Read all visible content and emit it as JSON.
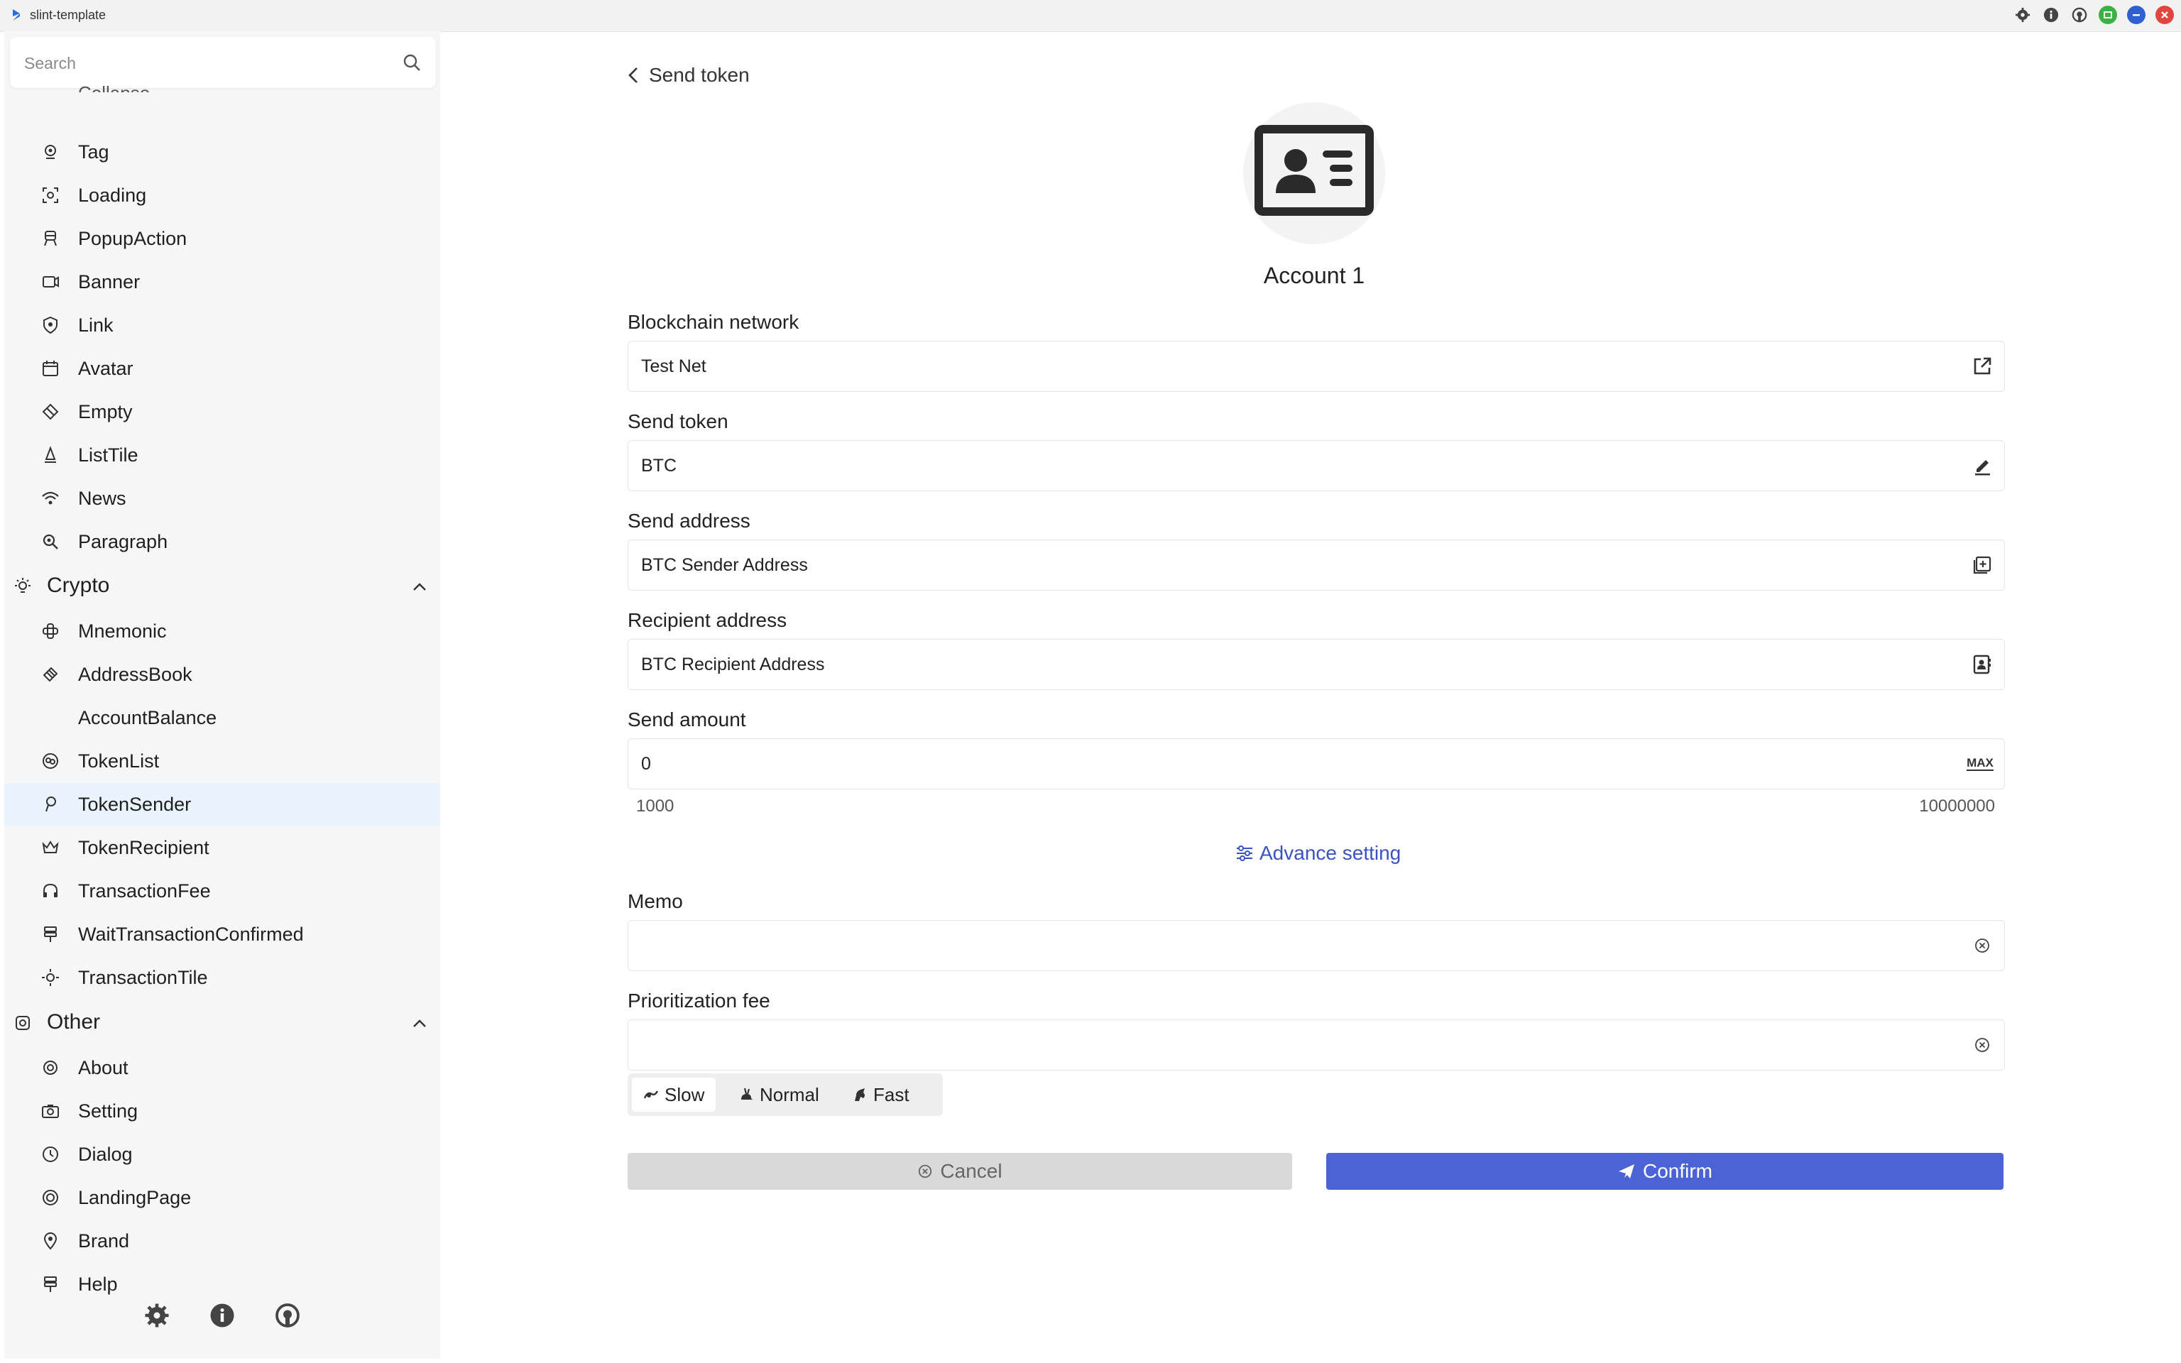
{
  "window": {
    "title": "slint-template",
    "icons": [
      "gear-icon",
      "info-icon",
      "github-icon",
      "maximize-icon",
      "minimize-icon",
      "close-icon"
    ],
    "colors": {
      "maximize": "#3cb043",
      "minimize": "#2f5fd1",
      "close": "#e0463f"
    }
  },
  "sidebar": {
    "search_placeholder": "Search",
    "cut_item_label": "Collapse",
    "items_top": [
      {
        "label": "Tag",
        "icon": "tag-icon"
      },
      {
        "label": "Loading",
        "icon": "loading-icon"
      },
      {
        "label": "PopupAction",
        "icon": "popup-icon"
      },
      {
        "label": "Banner",
        "icon": "banner-icon"
      },
      {
        "label": "Link",
        "icon": "link-icon"
      },
      {
        "label": "Avatar",
        "icon": "avatar-icon"
      },
      {
        "label": "Empty",
        "icon": "empty-icon"
      },
      {
        "label": "ListTile",
        "icon": "listtile-icon"
      },
      {
        "label": "News",
        "icon": "wifi-icon"
      },
      {
        "label": "Paragraph",
        "icon": "zoom-icon"
      }
    ],
    "group_crypto": {
      "label": "Crypto",
      "icon": "bulb-icon"
    },
    "items_crypto": [
      {
        "label": "Mnemonic",
        "icon": "mnemonic-icon"
      },
      {
        "label": "AddressBook",
        "icon": "addressbook-icon"
      },
      {
        "label": "AccountBalance",
        "icon": ""
      },
      {
        "label": "TokenList",
        "icon": "tokenlist-icon"
      },
      {
        "label": "TokenSender",
        "icon": "tokensender-icon"
      },
      {
        "label": "TokenRecipient",
        "icon": "crown-icon"
      },
      {
        "label": "TransactionFee",
        "icon": "headphones-icon"
      },
      {
        "label": "WaitTransactionConfirmed",
        "icon": "wait-icon"
      },
      {
        "label": "TransactionTile",
        "icon": "sun-icon"
      }
    ],
    "group_other": {
      "label": "Other",
      "icon": "other-icon"
    },
    "items_other": [
      {
        "label": "About",
        "icon": "about-icon"
      },
      {
        "label": "Setting",
        "icon": "camera-icon"
      },
      {
        "label": "Dialog",
        "icon": "clock-icon"
      },
      {
        "label": "LandingPage",
        "icon": "landing-icon"
      },
      {
        "label": "Brand",
        "icon": "pin-icon"
      },
      {
        "label": "Help",
        "icon": "help-icon"
      }
    ],
    "active_item": "TokenSender",
    "bottom_icons": [
      "gear-icon",
      "info-icon",
      "github-icon"
    ]
  },
  "main": {
    "back_label": "Send token",
    "account_name": "Account 1",
    "fields": {
      "network": {
        "label": "Blockchain network",
        "value": "Test Net"
      },
      "token": {
        "label": "Send token",
        "value": "BTC"
      },
      "send_address": {
        "label": "Send address",
        "value": "BTC Sender Address"
      },
      "recipient_address": {
        "label": "Recipient address",
        "value": "BTC Recipient Address"
      },
      "amount": {
        "label": "Send amount",
        "value": "0",
        "max_label": "MAX"
      },
      "memo": {
        "label": "Memo",
        "value": ""
      },
      "fee": {
        "label": "Prioritization fee",
        "value": ""
      }
    },
    "range_min": "1000",
    "range_max": "10000000",
    "advance_label": "Advance setting",
    "speeds": [
      {
        "label": "Slow",
        "selected": true
      },
      {
        "label": "Normal",
        "selected": false
      },
      {
        "label": "Fast",
        "selected": false
      }
    ],
    "cancel_label": "Cancel",
    "confirm_label": "Confirm",
    "accent_color": "#4b63d4"
  }
}
